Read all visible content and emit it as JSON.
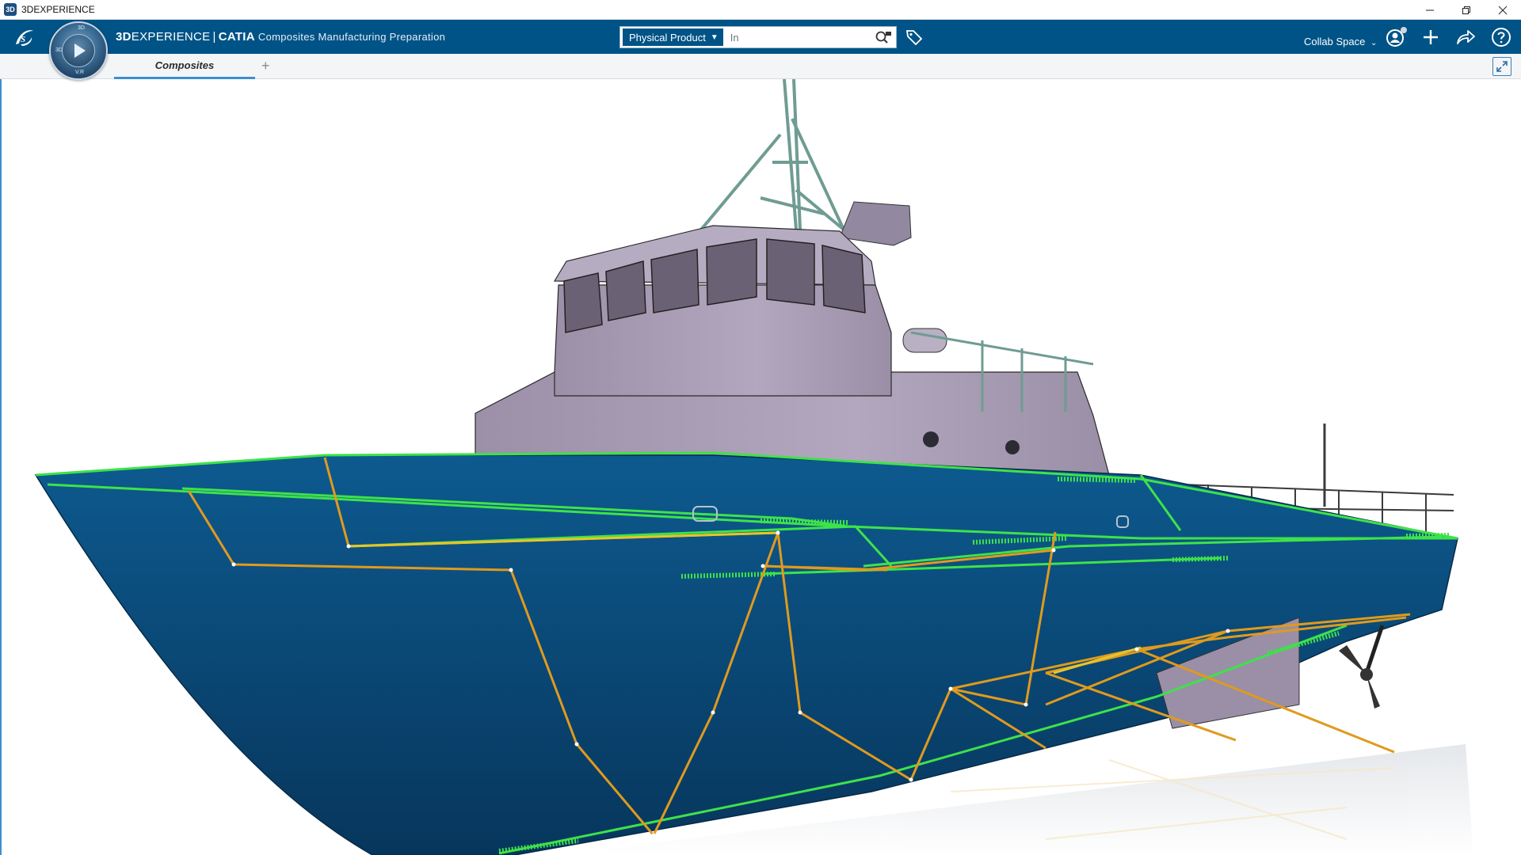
{
  "window": {
    "title": "3DEXPERIENCE",
    "controls": [
      "minimize",
      "restore",
      "close"
    ]
  },
  "header": {
    "brand_bold": "3D",
    "brand_rest": "EXPERIENCE",
    "brand_sep": "|",
    "brand_product": "CATIA",
    "app_name": "Composites Manufacturing Preparation",
    "compass_labels": {
      "top": "3D",
      "left": "3D",
      "bottom": "V.R"
    },
    "search": {
      "scope": "Physical Product",
      "placeholder": "In"
    },
    "collab_space": "Collab Space"
  },
  "tabs": [
    {
      "label": "Composites",
      "active": true
    }
  ],
  "tab_add_label": "+",
  "colors": {
    "topbar": "#005386",
    "hull": "#0a4a78",
    "superstructure": "#a79bb3",
    "mast": "#7aa69c",
    "ply_green": "#3ee24a",
    "ply_orange": "#e09a1e",
    "ply_yellow": "#e6c52a",
    "active_tab": "#3d8fd0"
  },
  "icons": {
    "app": "3ds-app-icon",
    "logo": "ds-logo-icon",
    "compass": "compass-icon",
    "search": "search-icon",
    "tag": "tag-icon",
    "user": "user-icon",
    "add": "plus-icon",
    "share": "share-icon",
    "help": "help-icon",
    "fullscreen": "fullscreen-icon"
  },
  "model": {
    "type": "3d-viewport",
    "description_visible": false
  }
}
